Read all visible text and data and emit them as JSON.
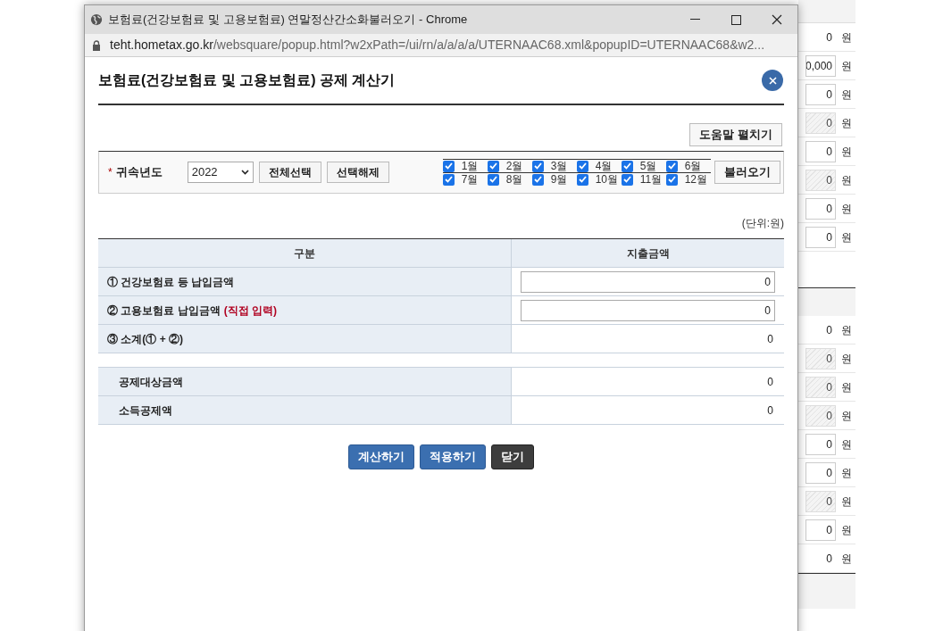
{
  "background": {
    "rows_top": [
      {
        "kind": "plain",
        "value": "0",
        "unit": "원"
      },
      {
        "kind": "input",
        "value": "0,000",
        "unit": "원"
      },
      {
        "kind": "input",
        "value": "0",
        "unit": "원"
      },
      {
        "kind": "disabled",
        "value": "0",
        "unit": "원"
      },
      {
        "kind": "input",
        "value": "0",
        "unit": "원"
      },
      {
        "kind": "disabled",
        "value": "0",
        "unit": "원"
      },
      {
        "kind": "input",
        "value": "0",
        "unit": "원"
      },
      {
        "kind": "input",
        "value": "0",
        "unit": "원"
      }
    ],
    "rows_bottom": [
      {
        "kind": "plain",
        "value": "0",
        "unit": "원"
      },
      {
        "kind": "disabled",
        "value": "0",
        "unit": "원"
      },
      {
        "kind": "disabled",
        "value": "0",
        "unit": "원"
      },
      {
        "kind": "disabled",
        "value": "0",
        "unit": "원"
      },
      {
        "kind": "input",
        "value": "0",
        "unit": "원"
      },
      {
        "kind": "input",
        "value": "0",
        "unit": "원"
      },
      {
        "kind": "disabled",
        "value": "0",
        "unit": "원"
      },
      {
        "kind": "input",
        "value": "0",
        "unit": "원"
      },
      {
        "kind": "plain",
        "value": "0",
        "unit": "원"
      }
    ]
  },
  "window": {
    "title": "보험료(건강보험료 및 고용보험료) 연말정산간소화불러오기 - Chrome",
    "url_host": "teht.hometax.go.kr",
    "url_path": "/websquare/popup.html?w2xPath=/ui/rn/a/a/a/a/UTERNAAC68.xml&popupID=UTERNAAC68&w2..."
  },
  "dialog": {
    "title": "보험료(건강보험료 및 고용보험료) 공제 계산기",
    "help_button": "도움말 펼치기",
    "filter": {
      "required_mark": "*",
      "label": "귀속년도",
      "year": "2022",
      "buttons": [
        "전체선택",
        "선택해제"
      ],
      "months": [
        {
          "label": "1월",
          "checked": true
        },
        {
          "label": "2월",
          "checked": true
        },
        {
          "label": "3월",
          "checked": true
        },
        {
          "label": "4월",
          "checked": true
        },
        {
          "label": "5월",
          "checked": true
        },
        {
          "label": "6월",
          "checked": true
        },
        {
          "label": "7월",
          "checked": true
        },
        {
          "label": "8월",
          "checked": true
        },
        {
          "label": "9월",
          "checked": true
        },
        {
          "label": "10월",
          "checked": true
        },
        {
          "label": "11월",
          "checked": true
        },
        {
          "label": "12월",
          "checked": true
        }
      ],
      "load_button": "불러오기"
    },
    "unit": "(단위:원)",
    "table": {
      "columns": [
        "구분",
        "지출금액"
      ],
      "rows": [
        {
          "label": "① 건강보험료 등 납입금액",
          "kind": "input",
          "value": "0"
        },
        {
          "label": "② 고용보험료 납입금액",
          "note": "(직접 입력)",
          "kind": "input",
          "value": "0"
        },
        {
          "label": "③ 소계(① + ②)",
          "kind": "plain",
          "value": "0"
        }
      ]
    },
    "result_table": {
      "rows": [
        {
          "label": "공제대상금액",
          "value": "0"
        },
        {
          "label": "소득공제액",
          "value": "0"
        }
      ]
    },
    "buttons": [
      {
        "label": "계산하기",
        "kind": "primary"
      },
      {
        "label": "적용하기",
        "kind": "primary"
      },
      {
        "label": "닫기",
        "kind": "dark"
      }
    ]
  }
}
